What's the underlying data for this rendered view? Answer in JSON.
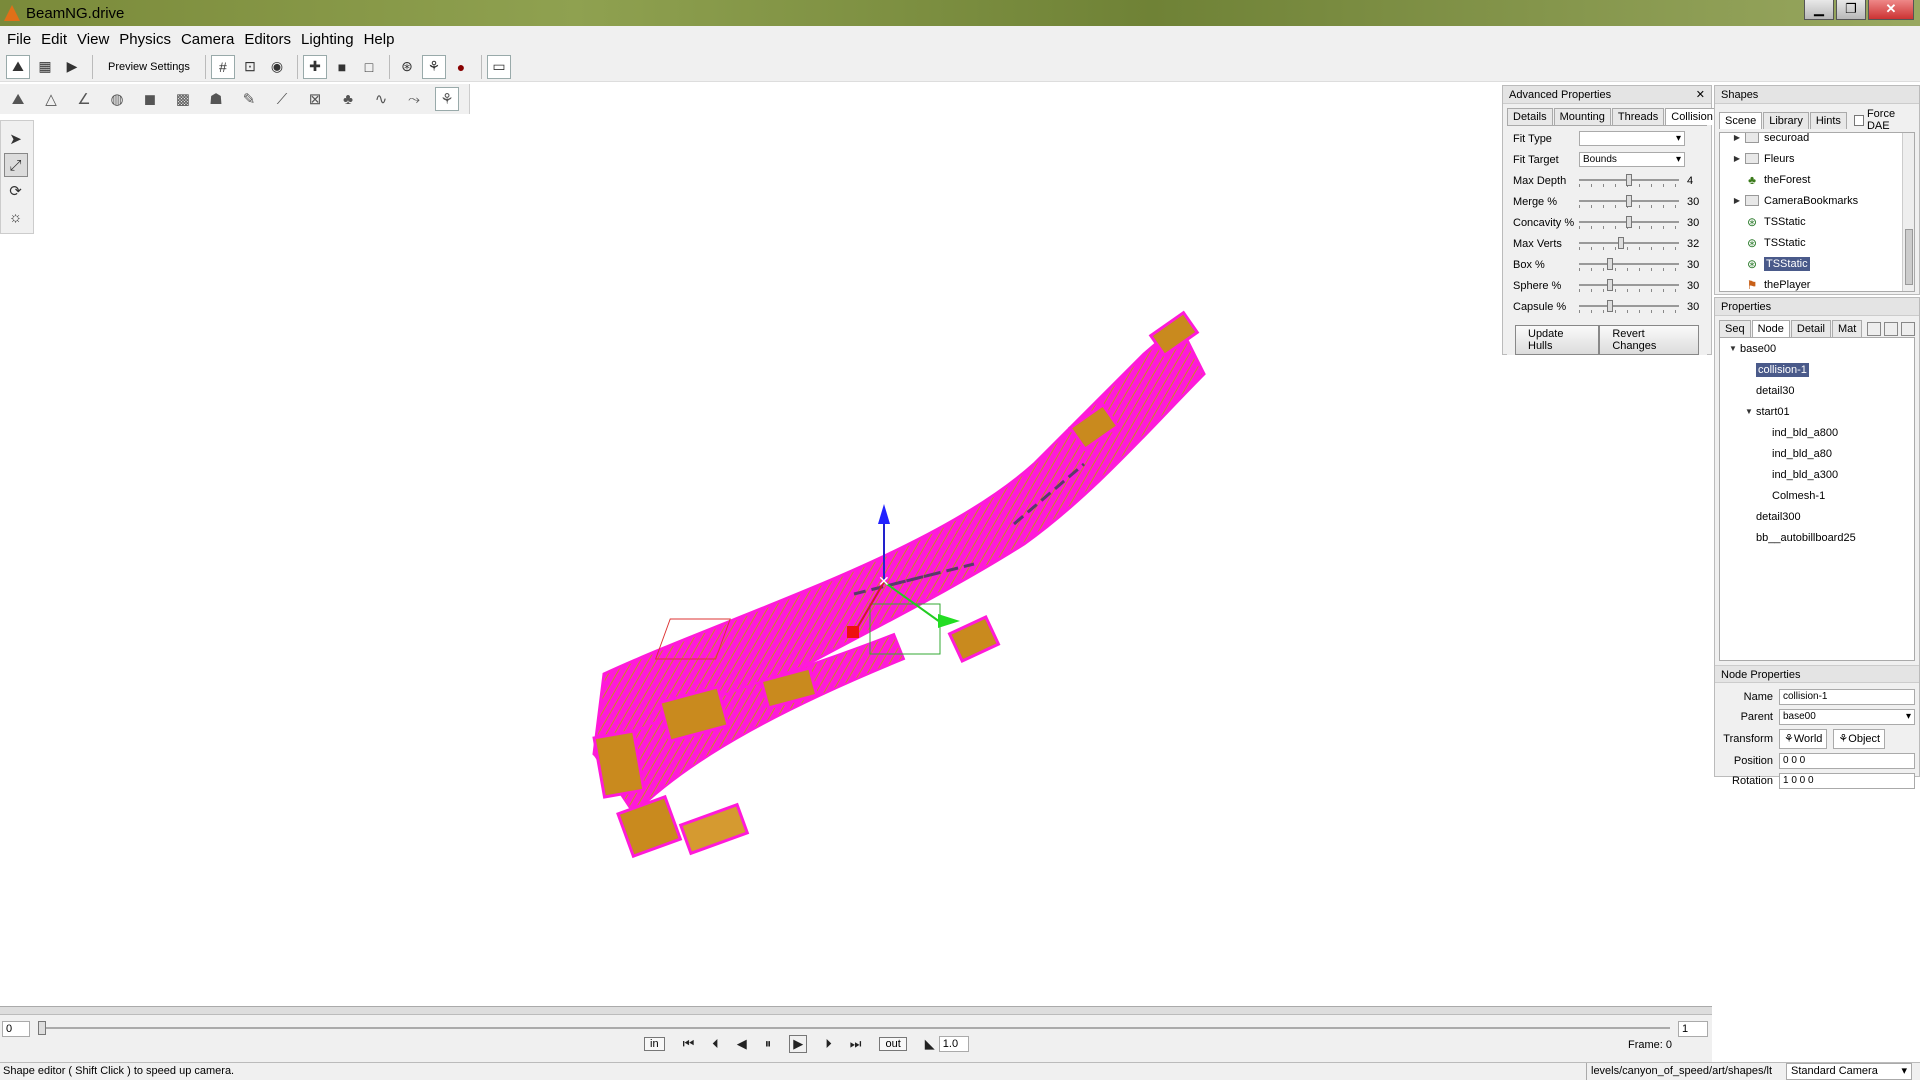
{
  "window": {
    "title": "BeamNG.drive",
    "minimize": "▁",
    "maximize": "❐",
    "close": "✕"
  },
  "menu": [
    "File",
    "Edit",
    "View",
    "Physics",
    "Camera",
    "Editors",
    "Lighting",
    "Help"
  ],
  "toolbar": {
    "preview_settings": "Preview Settings"
  },
  "advanced_properties": {
    "title": "Advanced Properties",
    "close": "✕",
    "tabs": [
      "Details",
      "Mounting",
      "Threads",
      "Collision"
    ],
    "fit_type_label": "Fit Type",
    "fit_type_value": "",
    "fit_target_label": "Fit Target",
    "fit_target_value": "Bounds",
    "sliders": [
      {
        "label": "Max Depth",
        "value": "4",
        "pos": 0.5
      },
      {
        "label": "Merge %",
        "value": "30",
        "pos": 0.5
      },
      {
        "label": "Concavity %",
        "value": "30",
        "pos": 0.5
      },
      {
        "label": "Max Verts",
        "value": "32",
        "pos": 0.42
      },
      {
        "label": "Box %",
        "value": "30",
        "pos": 0.3
      },
      {
        "label": "Sphere %",
        "value": "30",
        "pos": 0.3
      },
      {
        "label": "Capsule %",
        "value": "30",
        "pos": 0.3
      }
    ],
    "update_hulls": "Update Hulls",
    "revert_changes": "Revert Changes"
  },
  "shapes": {
    "title": "Shapes",
    "tabs": [
      "Scene",
      "Library",
      "Hints"
    ],
    "force_dae": "Force DAE",
    "items": [
      {
        "label": "securoad",
        "type": "folder",
        "expandable": true
      },
      {
        "label": "Fleurs",
        "type": "folder",
        "expandable": true
      },
      {
        "label": "theForest",
        "type": "forest",
        "expandable": false
      },
      {
        "label": "CameraBookmarks",
        "type": "folder",
        "expandable": true
      },
      {
        "label": "TSStatic",
        "type": "static",
        "expandable": false
      },
      {
        "label": "TSStatic",
        "type": "static",
        "expandable": false
      },
      {
        "label": "TSStatic",
        "type": "static",
        "expandable": false,
        "selected": true
      },
      {
        "label": "thePlayer",
        "type": "player",
        "expandable": false
      }
    ]
  },
  "properties": {
    "title": "Properties",
    "tabs": [
      "Seq",
      "Node",
      "Detail",
      "Mat"
    ],
    "nodes": [
      {
        "label": "base00",
        "level": 0,
        "expanded": true
      },
      {
        "label": "collision-1",
        "level": 1,
        "selected": true
      },
      {
        "label": "detail30",
        "level": 1
      },
      {
        "label": "start01",
        "level": 1,
        "expanded": true
      },
      {
        "label": "ind_bld_a800",
        "level": 2
      },
      {
        "label": "ind_bld_a80",
        "level": 2
      },
      {
        "label": "ind_bld_a300",
        "level": 2
      },
      {
        "label": "Colmesh-1",
        "level": 2
      },
      {
        "label": "detail300",
        "level": 1
      },
      {
        "label": "bb__autobillboard25",
        "level": 1
      }
    ],
    "node_properties": {
      "title": "Node Properties",
      "name_label": "Name",
      "name_value": "collision-1",
      "parent_label": "Parent",
      "parent_value": "base00",
      "transform_label": "Transform",
      "world": "World",
      "object": "Object",
      "position_label": "Position",
      "position_value": "0 0 0",
      "rotation_label": "Rotation",
      "rotation_value": "1 0 0 0"
    }
  },
  "timeline": {
    "start": "0",
    "end": "1",
    "in": "in",
    "out": "out",
    "speed": "1.0",
    "frame": "Frame:  0"
  },
  "status": {
    "message": "Shape editor ( Shift Click ) to speed up camera.",
    "path": "levels/canyon_of_speed/art/shapes/lt",
    "camera": "Standard Camera"
  },
  "colors": {
    "wire": "#ff1ad9",
    "fill": "#c98a1e",
    "selection": "#4a5a8a"
  }
}
